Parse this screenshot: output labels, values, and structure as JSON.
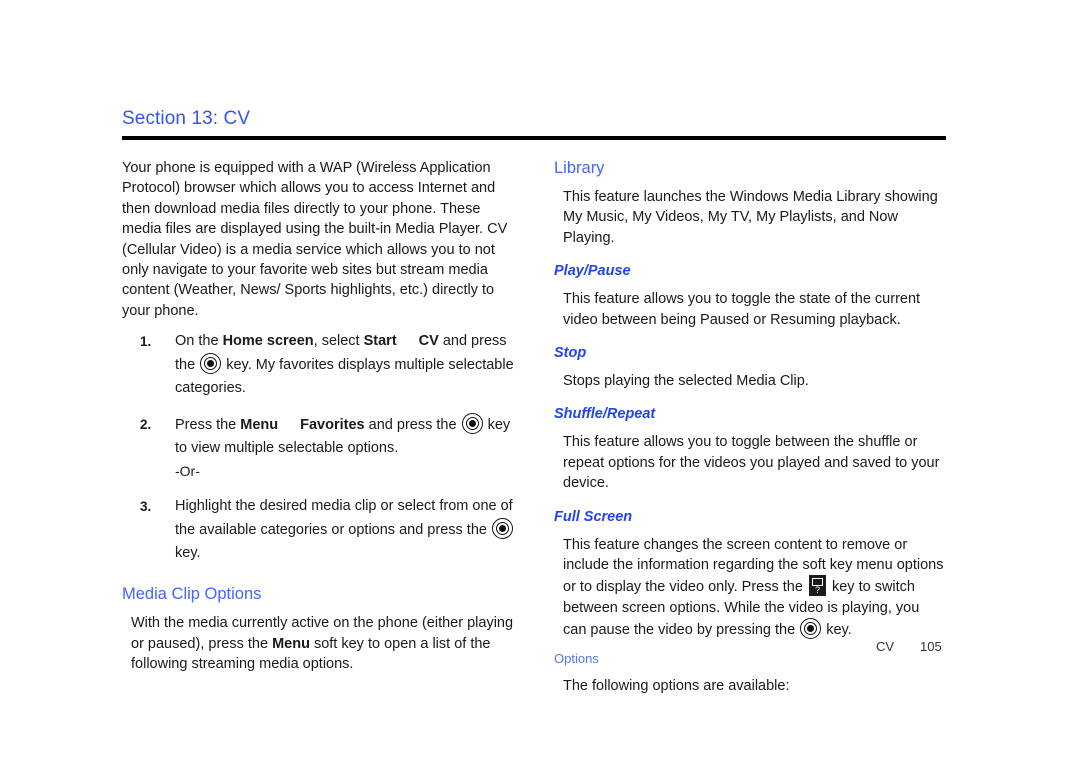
{
  "document": {
    "section_title": "Section 13: CV",
    "accent_color": "#3355ee",
    "subheading_color": "#2244ee"
  },
  "left_column": {
    "intro_paragraph": "Your phone is equipped with a WAP (Wireless Application Protocol) browser which allows you to access Internet and then download media files directly to your phone. These media files are displayed using the built-in Media Player. CV (Cellular Video) is a media service which allows you to not only navigate to your favorite web sites but stream media content (Weather, News/ Sports highlights, etc.) directly to your phone.",
    "steps": [
      {
        "number": "1.",
        "part1": "On the ",
        "bold1": "Home screen",
        "part2": ", select ",
        "bold2": "Start",
        "bold3": "CV",
        "part3": " and press the ",
        "part4": " key. My favorites displays multiple selectable categories."
      },
      {
        "number": "2.",
        "part1": "Press the ",
        "bold1": "Menu",
        "bold2": "Favorites",
        "part2": " and press the ",
        "part3": " key to view multiple selectable options."
      },
      {
        "number": "3.",
        "part1": "Highlight the desired media clip or select from one of the available categories or options and press the ",
        "part2": " key."
      }
    ],
    "or_text": "-Or-",
    "media_clip_options": {
      "heading": "Media Clip Options",
      "part1": "With the media currently active on the phone (either playing or paused), press the ",
      "bold1": "Menu",
      "part2": " soft key to open a list of the following streaming media options."
    }
  },
  "right_column": {
    "library": {
      "heading": "Library",
      "body": "This feature launches the Windows Media Library showing My Music, My Videos, My TV, My Playlists, and Now Playing."
    },
    "play_pause": {
      "heading": "Play/Pause",
      "body": "This feature allows you to toggle the state of the current video between being Paused or Resuming playback."
    },
    "stop": {
      "heading": "Stop",
      "body": "Stops playing the selected Media Clip."
    },
    "shuffle_repeat": {
      "heading": "Shuffle/Repeat",
      "body": "This feature allows you to toggle between the shuffle or repeat options for the videos you played and saved to your device."
    },
    "full_screen": {
      "heading": "Full Screen",
      "part1": "This feature changes the screen content to remove or include the information regarding the soft key menu options or to display the video only. Press the ",
      "part2": " key to switch between screen options. While the video is playing, you can pause the video by pressing the ",
      "part3": " key."
    },
    "options": {
      "heading": "Options",
      "body": "The following options are available:"
    }
  },
  "footer": {
    "label": "CV",
    "page_number": "105"
  }
}
